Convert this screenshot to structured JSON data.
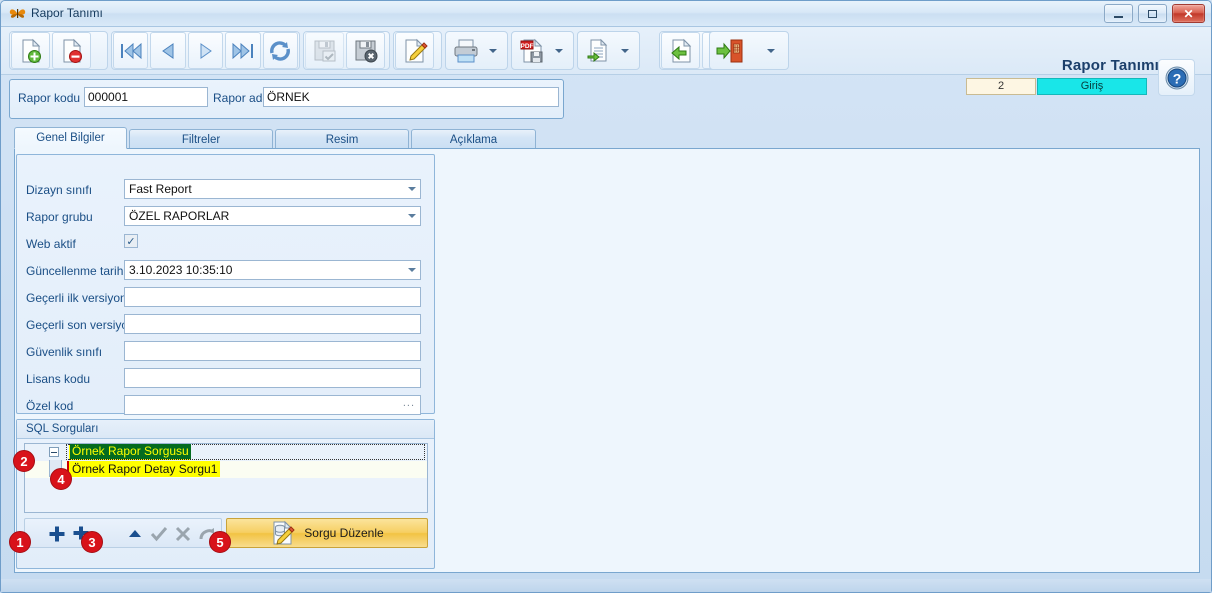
{
  "window": {
    "title": "Rapor Tanımı",
    "app_icon": "butterfly-icon",
    "controls": {
      "minimize": "minimize-icon",
      "maximize": "maximize-icon",
      "close": "✕"
    }
  },
  "toolbar": {
    "groups": [
      {
        "name": "record-group",
        "buttons": [
          {
            "name": "new-record-button",
            "icon": "page-add-icon",
            "enabled": true
          },
          {
            "name": "delete-record-button",
            "icon": "page-delete-icon",
            "enabled": true
          }
        ]
      },
      {
        "name": "navigation-group",
        "buttons": [
          {
            "name": "first-record-button",
            "icon": "first-icon",
            "enabled": true
          },
          {
            "name": "previous-record-button",
            "icon": "previous-icon",
            "enabled": true
          },
          {
            "name": "next-record-button",
            "icon": "next-icon",
            "enabled": true
          },
          {
            "name": "last-record-button",
            "icon": "last-icon",
            "enabled": true
          },
          {
            "name": "refresh-button",
            "icon": "refresh-icon",
            "enabled": true
          }
        ]
      },
      {
        "name": "save-group",
        "buttons": [
          {
            "name": "save-button",
            "icon": "disk-check-icon",
            "enabled": false
          },
          {
            "name": "cancel-save-button",
            "icon": "disk-cancel-icon",
            "enabled": true
          }
        ]
      },
      {
        "name": "edit-group",
        "buttons": [
          {
            "name": "edit-button",
            "icon": "page-pencil-icon",
            "enabled": true
          }
        ]
      },
      {
        "name": "print-group",
        "buttons": [
          {
            "name": "print-button",
            "icon": "printer-icon",
            "enabled": true,
            "dropdown": true
          }
        ]
      },
      {
        "name": "export-group",
        "buttons": [
          {
            "name": "export-pdf-button",
            "icon": "pdf-save-icon",
            "enabled": true,
            "dropdown": true
          }
        ]
      },
      {
        "name": "copy-group",
        "buttons": [
          {
            "name": "copy-records-button",
            "icon": "page-copy-icon",
            "enabled": true,
            "dropdown": true
          }
        ]
      },
      {
        "name": "tools-group",
        "buttons": [
          {
            "name": "back-button",
            "icon": "page-back-icon",
            "enabled": true
          },
          {
            "name": "settings-button",
            "icon": "page-wrench-icon",
            "enabled": true
          }
        ]
      },
      {
        "name": "exit-group",
        "buttons": [
          {
            "name": "exit-button",
            "icon": "door-exit-icon",
            "enabled": true,
            "dropdown": true
          }
        ]
      }
    ]
  },
  "header": {
    "title": "Rapor Tanımı",
    "record_number": "2",
    "mode": "Giriş",
    "help_icon": "question-mark-icon",
    "mode_color": "#19e6e8",
    "number_color": "#fdf6e3"
  },
  "code_panel": {
    "rapor_kodu_label": "Rapor kodu",
    "rapor_kodu_value": "000001",
    "rapor_adi_label": "Rapor adı",
    "rapor_adi_value": "ÖRNEK"
  },
  "tabs": [
    {
      "label": "Genel Bilgiler",
      "active": true
    },
    {
      "label": "Filtreler",
      "active": false
    },
    {
      "label": "Resim",
      "active": false
    },
    {
      "label": "Açıklama",
      "active": false
    }
  ],
  "fields": [
    {
      "name": "dizayn-sinifi",
      "label": "Dizayn sınıfı",
      "value": "Fast Report",
      "type": "combo"
    },
    {
      "name": "rapor-grubu",
      "label": "Rapor grubu",
      "value": "ÖZEL RAPORLAR",
      "type": "combo"
    },
    {
      "name": "web-aktif",
      "label": "Web aktif",
      "value": "✓",
      "type": "checkbox",
      "checked": true
    },
    {
      "name": "guncellenme-tarihi",
      "label": "Güncellenme tarihi",
      "value": "3.10.2023 10:35:10",
      "type": "combo"
    },
    {
      "name": "gecerli-ilk-versiyon",
      "label": "Geçerli ilk versiyon",
      "value": "",
      "type": "text"
    },
    {
      "name": "gecerli-son-versiyon",
      "label": "Geçerli son versiyon",
      "value": "",
      "type": "text"
    },
    {
      "name": "guvenlik-sinifi",
      "label": "Güvenlik sınıfı",
      "value": "",
      "type": "text"
    },
    {
      "name": "lisans-kodu",
      "label": "Lisans kodu",
      "value": "",
      "type": "text"
    },
    {
      "name": "ozel-kod",
      "label": "Özel kod",
      "value": "",
      "type": "text-ellipsis",
      "ellipsis": "..."
    }
  ],
  "sql_section": {
    "caption": "SQL Sorguları",
    "tree": [
      {
        "name": "tree-node-parent",
        "label": "Örnek Rapor Sorgusu",
        "selected": true,
        "expanded": true,
        "highlight": "#ffff00",
        "select_bg": "#046b1f",
        "select_fg": "#ffff00"
      },
      {
        "name": "tree-node-child",
        "label": "Örnek Rapor Detay Sorgu1",
        "selected": false,
        "expanded": false,
        "highlight": "#ffff00"
      }
    ],
    "mini_toolbar": [
      {
        "name": "add-query-button",
        "icon": "plus-icon"
      },
      {
        "name": "add-sub-query-button",
        "icon": "plus-sub-icon"
      },
      {
        "name": "move-up-button",
        "icon": "triangle-up-icon"
      },
      {
        "name": "confirm-button",
        "icon": "check-icon"
      },
      {
        "name": "cancel-button",
        "icon": "x-icon"
      },
      {
        "name": "undo-button",
        "icon": "undo-arrow-icon"
      }
    ],
    "edit_button": {
      "label": "Sorgu Düzenle",
      "icon": "database-pencil-icon",
      "color": "#f2c343"
    }
  },
  "annotations": [
    {
      "id": "1",
      "number": "1"
    },
    {
      "id": "2",
      "number": "2"
    },
    {
      "id": "3",
      "number": "3"
    },
    {
      "id": "4",
      "number": "4"
    },
    {
      "id": "5",
      "number": "5"
    }
  ]
}
